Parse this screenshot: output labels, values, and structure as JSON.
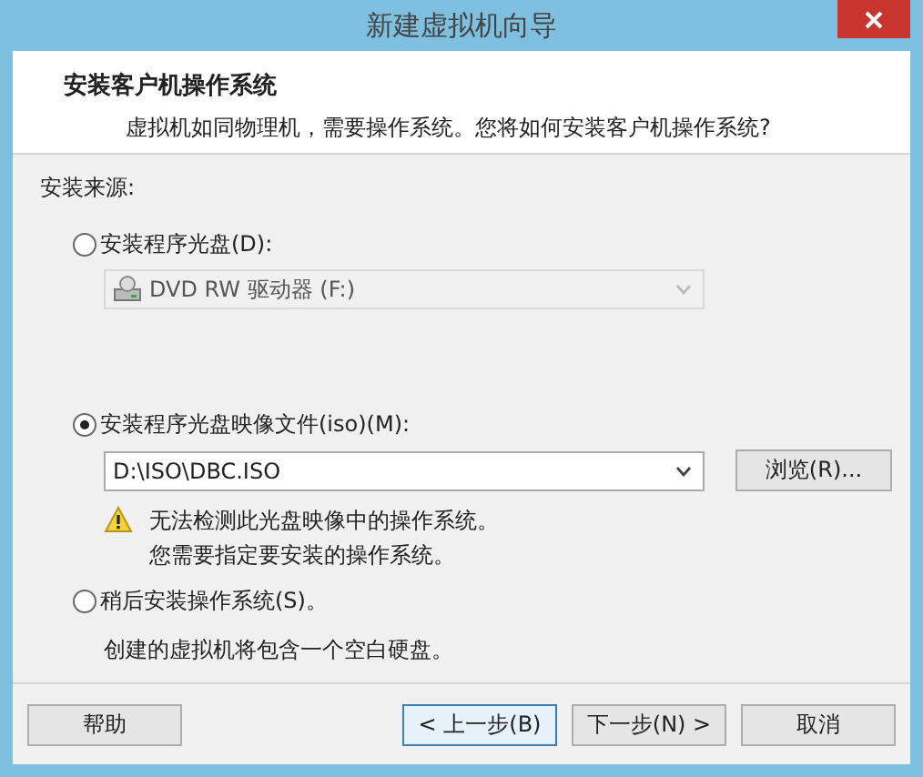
{
  "window": {
    "title": "新建虚拟机向导"
  },
  "header": {
    "title": "安装客户机操作系统",
    "subtitle": "虚拟机如同物理机，需要操作系统。您将如何安装客户机操作系统?"
  },
  "source_label": "安装来源:",
  "options": [
    {
      "label": "安装程序光盘(D):",
      "selected": false,
      "dropdown": {
        "value": "DVD RW 驱动器 (F:)",
        "disabled": true,
        "drive_icon": true
      }
    },
    {
      "label": "安装程序光盘映像文件(iso)(M):",
      "selected": true,
      "dropdown": {
        "value": "D:\\ISO\\DBC.ISO",
        "disabled": false,
        "drive_icon": false
      },
      "browse_button": "浏览(R)...",
      "warning": [
        "无法检测此光盘映像中的操作系统。",
        "您需要指定要安装的操作系统。"
      ]
    },
    {
      "label": "稍后安装操作系统(S)。",
      "selected": false,
      "note": "创建的虚拟机将包含一个空白硬盘。"
    }
  ],
  "buttons": [
    {
      "label": "帮助",
      "focused": false
    },
    {
      "label": "< 上一步(B)",
      "focused": true
    },
    {
      "label": "下一步(N) >",
      "focused": false
    },
    {
      "label": "取消",
      "focused": false
    }
  ]
}
